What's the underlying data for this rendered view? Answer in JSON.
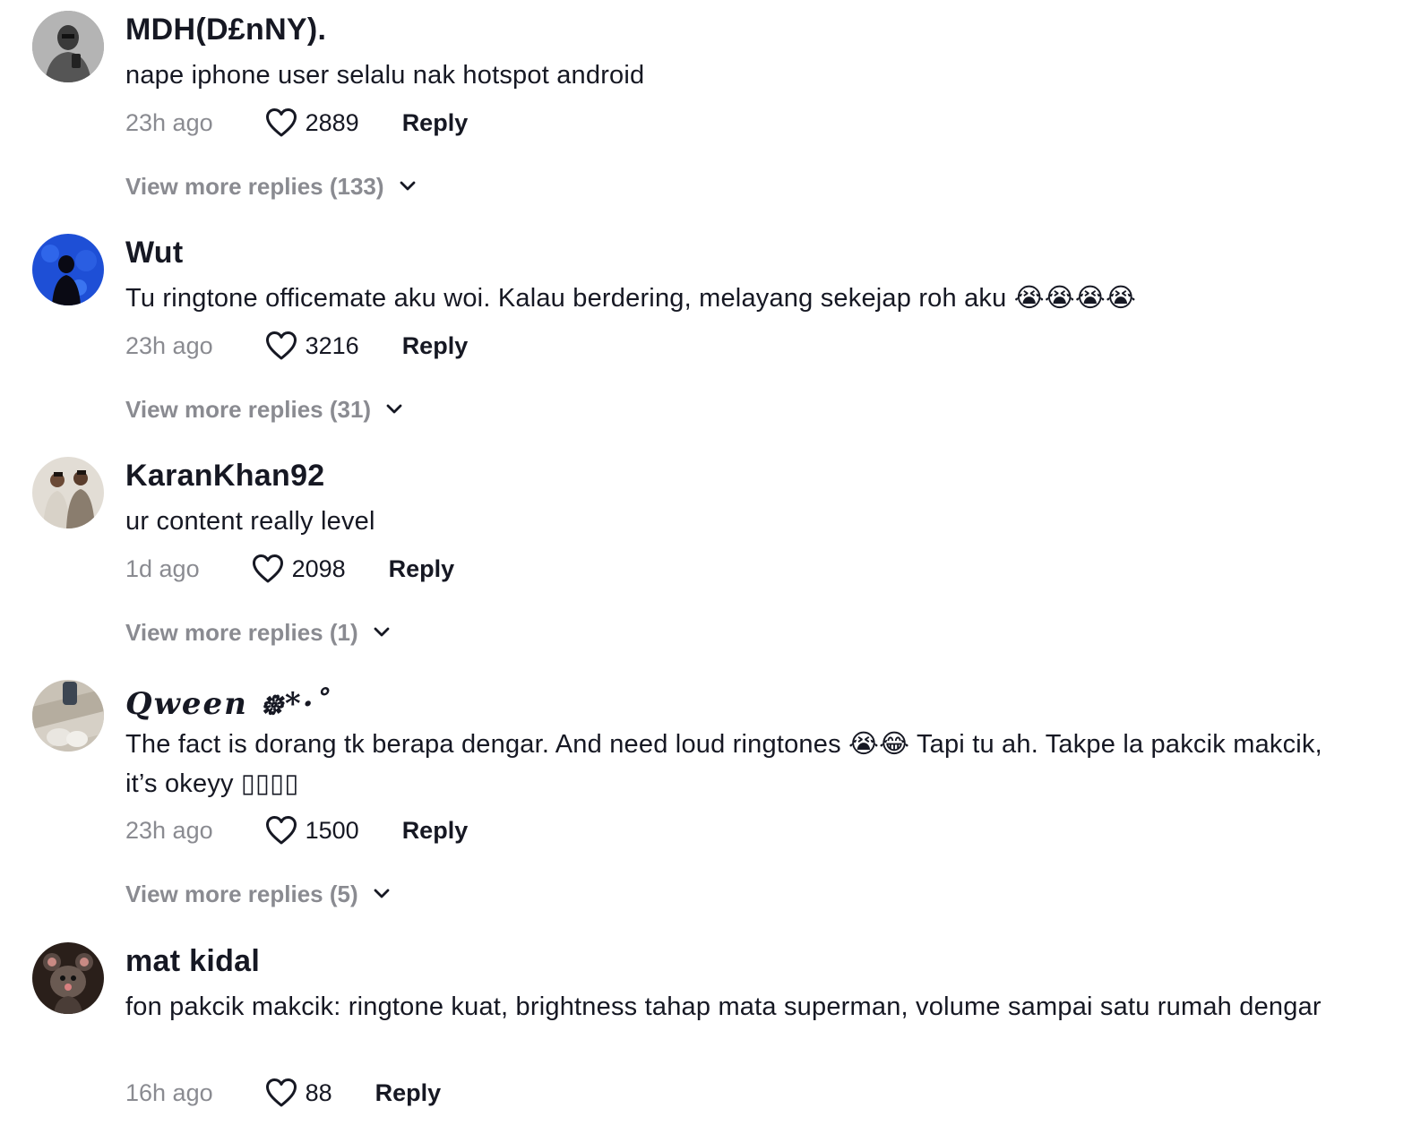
{
  "comments": [
    {
      "username": "MDH(D£nNY).",
      "text": "nape iphone user selalu nak hotspot android",
      "time": "23h ago",
      "likes": "2889",
      "reply_label": "Reply",
      "view_more": "View more replies (133)"
    },
    {
      "username": "Wut",
      "text": "Tu ringtone officemate aku woi. Kalau berdering, melayang sekejap roh aku 😭😭😭😭",
      "time": "23h ago",
      "likes": "3216",
      "reply_label": "Reply",
      "view_more": "View more replies (31)"
    },
    {
      "username": "KaranKhan92",
      "text": "ur content really level",
      "time": "1d ago",
      "likes": "2098",
      "reply_label": "Reply",
      "view_more": "View more replies (1)"
    },
    {
      "username": "𝑸𝒘𝒆𝒆𝒏 ᪥*·˚",
      "text": "The fact is dorang tk berapa dengar. And need loud ringtones 😭😂 Tapi tu ah. Takpe la pakcik makcik, it’s okeyy ▯▯▯▯",
      "time": "23h ago",
      "likes": "1500",
      "reply_label": "Reply",
      "view_more": "View more replies (5)"
    },
    {
      "username": "mat kidal",
      "text": "fon pakcik makcik: ringtone kuat, brightness tahap mata superman, volume sampai satu rumah dengar",
      "time": "16h ago",
      "likes": "88",
      "reply_label": "Reply",
      "view_more": ""
    }
  ],
  "icons": {
    "like": "heart-outline-icon",
    "expand": "chevron-down-icon"
  },
  "colors": {
    "primary_text": "#161823",
    "secondary_text": "#8a8b91",
    "background": "#ffffff"
  }
}
